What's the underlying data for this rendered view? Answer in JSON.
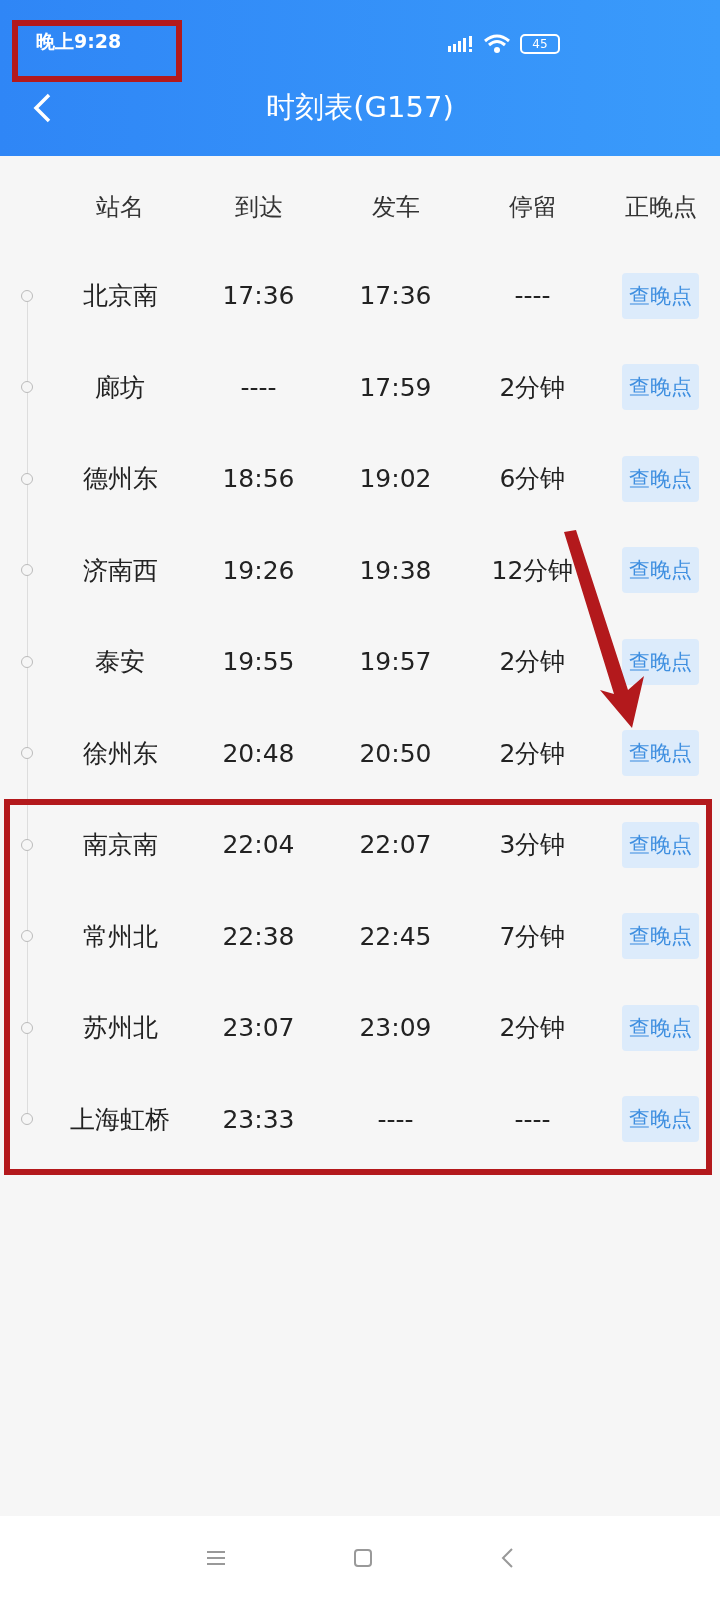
{
  "status_bar": {
    "time": "晚上9:28",
    "battery": "45"
  },
  "header": {
    "title": "时刻表(G157)"
  },
  "table": {
    "columns": [
      "站名",
      "到达",
      "发车",
      "停留",
      "正晚点"
    ],
    "rows": [
      {
        "station": "北京南",
        "arrive": "17:36",
        "depart": "17:36",
        "stop": "----",
        "action": "查晚点"
      },
      {
        "station": "廊坊",
        "arrive": "----",
        "depart": "17:59",
        "stop": "2分钟",
        "action": "查晚点"
      },
      {
        "station": "德州东",
        "arrive": "18:56",
        "depart": "19:02",
        "stop": "6分钟",
        "action": "查晚点"
      },
      {
        "station": "济南西",
        "arrive": "19:26",
        "depart": "19:38",
        "stop": "12分钟",
        "action": "查晚点"
      },
      {
        "station": "泰安",
        "arrive": "19:55",
        "depart": "19:57",
        "stop": "2分钟",
        "action": "查晚点"
      },
      {
        "station": "徐州东",
        "arrive": "20:48",
        "depart": "20:50",
        "stop": "2分钟",
        "action": "查晚点"
      },
      {
        "station": "南京南",
        "arrive": "22:04",
        "depart": "22:07",
        "stop": "3分钟",
        "action": "查晚点"
      },
      {
        "station": "常州北",
        "arrive": "22:38",
        "depart": "22:45",
        "stop": "7分钟",
        "action": "查晚点"
      },
      {
        "station": "苏州北",
        "arrive": "23:07",
        "depart": "23:09",
        "stop": "2分钟",
        "action": "查晚点"
      },
      {
        "station": "上海虹桥",
        "arrive": "23:33",
        "depart": "----",
        "stop": "----",
        "action": "查晚点"
      }
    ]
  },
  "annotations": [
    {
      "kind": "time-frame"
    },
    {
      "kind": "rows-frame"
    },
    {
      "kind": "arrow"
    }
  ]
}
